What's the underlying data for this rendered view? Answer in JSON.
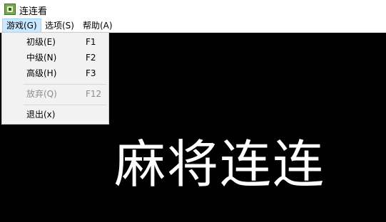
{
  "window": {
    "title": "连连看"
  },
  "menubar": {
    "items": [
      {
        "label": "游戏(G)"
      },
      {
        "label": "选项(S)"
      },
      {
        "label": "帮助(A)"
      }
    ]
  },
  "game_menu": {
    "items": [
      {
        "label": "初级(E)",
        "shortcut": "F1",
        "enabled": true
      },
      {
        "label": "中级(N)",
        "shortcut": "F2",
        "enabled": true
      },
      {
        "label": "高级(H)",
        "shortcut": "F3",
        "enabled": true
      },
      {
        "label": "放弃(Q)",
        "shortcut": "F12",
        "enabled": false
      },
      {
        "label": "退出(x)",
        "shortcut": "",
        "enabled": true
      }
    ]
  },
  "stage": {
    "logo_text": "麻将连连"
  },
  "colors": {
    "background": "#000000",
    "menu_highlight": "#cce8ff",
    "disabled_text": "#8d8d8d"
  }
}
